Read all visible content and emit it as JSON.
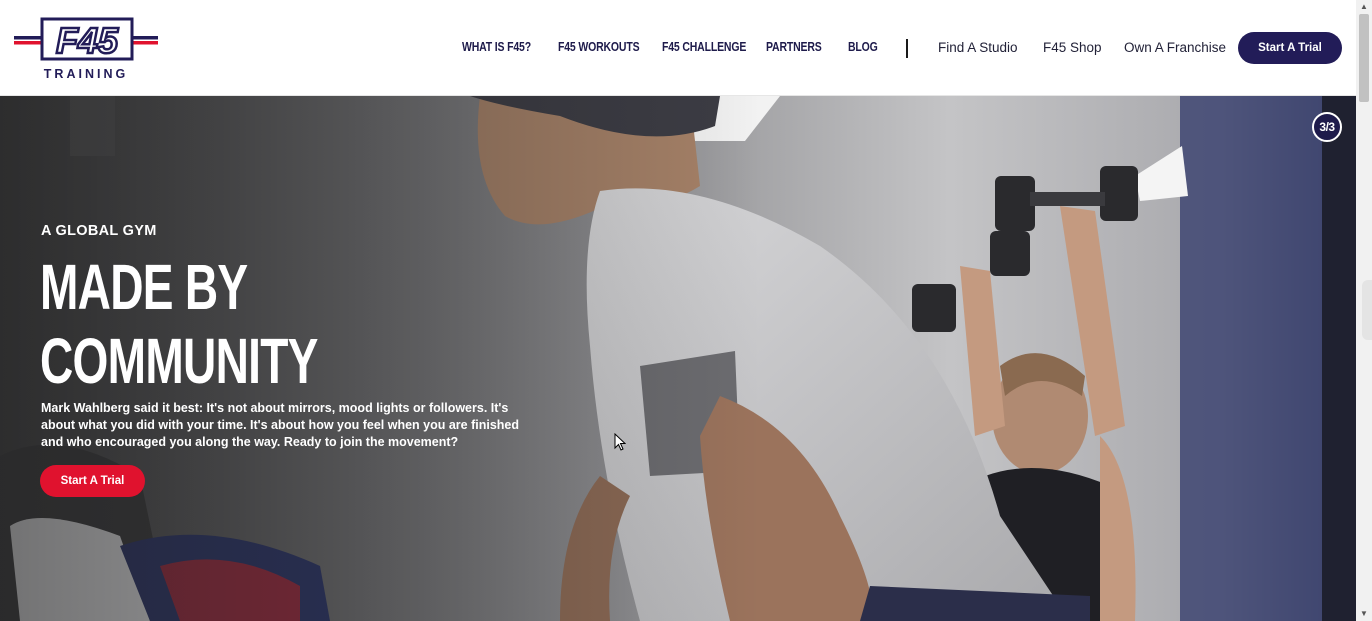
{
  "brand": {
    "logo_text": "F45",
    "logo_subtext": "TRAINING",
    "colors": {
      "navy": "#221c58",
      "red": "#e0122e",
      "white": "#ffffff"
    }
  },
  "nav": {
    "primary": [
      {
        "label": "WHAT IS F45?"
      },
      {
        "label": "F45 WORKOUTS"
      },
      {
        "label": "F45 CHALLENGE"
      },
      {
        "label": "PARTNERS"
      },
      {
        "label": "BLOG"
      }
    ],
    "secondary": [
      {
        "label": "Find A Studio"
      },
      {
        "label": "F45 Shop"
      },
      {
        "label": "Own A Franchise"
      }
    ],
    "cta_label": "Start A Trial"
  },
  "hero": {
    "slide_counter": "3/3",
    "eyebrow": "A GLOBAL GYM",
    "headline_line1": "MADE BY",
    "headline_line2": "COMMUNITY",
    "body": "Mark Wahlberg said it best: It's not about mirrors, mood lights or followers. It's about what you did with your time. It's about how you feel when you are finished and who encouraged you along the way. Ready to join the movement?",
    "cta_label": "Start A Trial"
  }
}
